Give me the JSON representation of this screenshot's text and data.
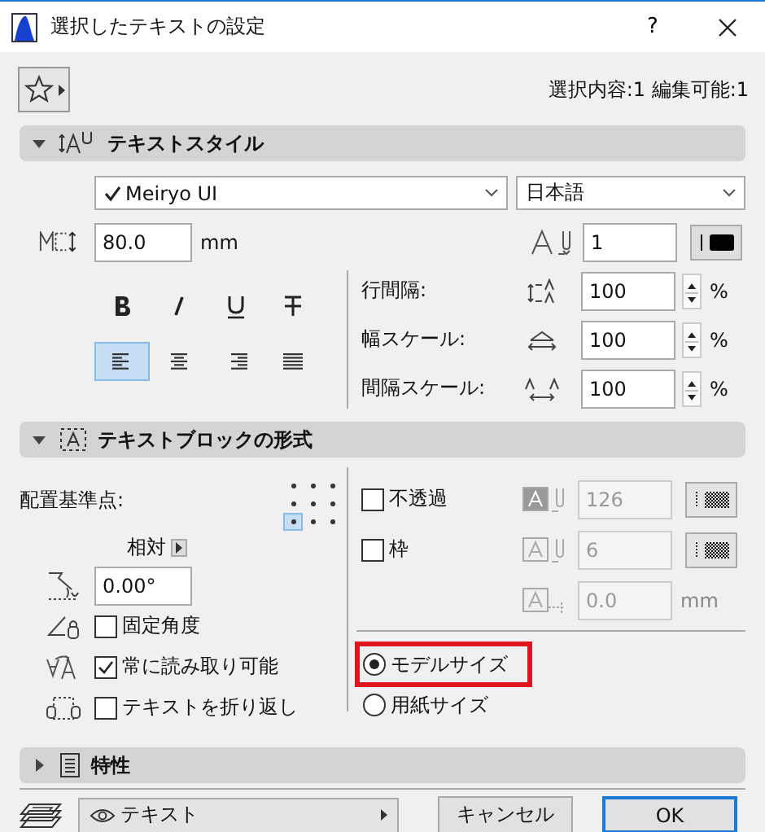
{
  "window": {
    "title": "選択したテキストの設定",
    "help": "?"
  },
  "toolbar": {
    "selection_info": "選択内容:1 編集可能:1"
  },
  "text_style": {
    "title": "テキストスタイル",
    "expanded": true,
    "font": {
      "value": "Meiryo UI",
      "checked": true
    },
    "language": "日本語",
    "size": "80.0",
    "size_unit": "mm",
    "pen": "1",
    "styles": [
      {
        "kind": "bold",
        "selected": false
      },
      {
        "kind": "italic",
        "selected": false
      },
      {
        "kind": "underline",
        "selected": false
      },
      {
        "kind": "strike",
        "selected": false
      }
    ],
    "alignments": [
      {
        "kind": "left",
        "selected": true
      },
      {
        "kind": "center",
        "selected": false
      },
      {
        "kind": "right",
        "selected": false
      },
      {
        "kind": "justify",
        "selected": false
      }
    ],
    "spacing": [
      {
        "kind": "line",
        "label": "行間隔:",
        "value": "100",
        "unit": "%"
      },
      {
        "kind": "width",
        "label": "幅スケール:",
        "value": "100",
        "unit": "%"
      },
      {
        "kind": "char",
        "label": "間隔スケール:",
        "value": "100",
        "unit": "%"
      }
    ]
  },
  "text_block": {
    "title": "テキストブロックの形式",
    "expanded": true,
    "anchor_label": "配置基準点:",
    "anchor_points": [
      {
        "selected": false
      },
      {
        "selected": false
      },
      {
        "selected": false
      },
      {
        "selected": false
      },
      {
        "selected": false
      },
      {
        "selected": false
      },
      {
        "selected": true
      },
      {
        "selected": false
      },
      {
        "selected": false
      }
    ],
    "relative_label": "相対",
    "angle": "0.00°",
    "options": [
      {
        "kind": "fixed_angle",
        "label": "固定角度",
        "checked": false
      },
      {
        "kind": "readable",
        "label": "常に読み取り可能",
        "checked": true
      },
      {
        "kind": "wrap",
        "label": "テキストを折り返し",
        "checked": false
      }
    ],
    "opaque": {
      "label": "不透過",
      "checked": false,
      "pen": "126"
    },
    "frame": {
      "label": "枠",
      "checked": false,
      "pen": "6"
    },
    "margin": {
      "value": "0.0",
      "unit": "mm"
    },
    "size_modes": [
      {
        "label": "モデルサイズ",
        "selected": true,
        "highlighted": true
      },
      {
        "label": "用紙サイズ",
        "selected": false,
        "highlighted": false
      }
    ]
  },
  "properties": {
    "title": "特性",
    "expanded": false
  },
  "footer": {
    "layer": "テキスト",
    "cancel": "キャンセル",
    "ok": "OK"
  }
}
